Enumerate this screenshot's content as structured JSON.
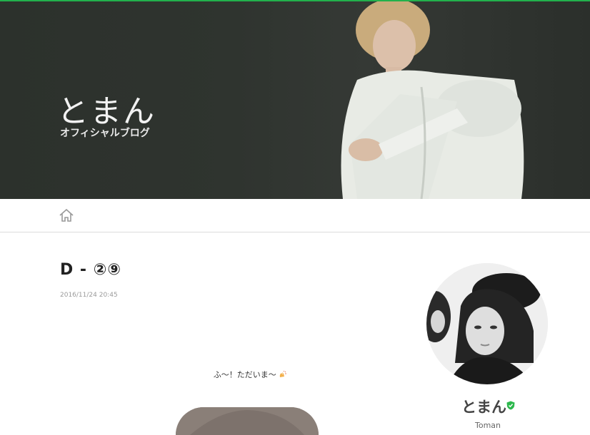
{
  "header": {
    "blog_title": "とまん",
    "blog_subtitle": "オフィシャルブログ"
  },
  "nav": {
    "home_icon": "home-icon"
  },
  "entry": {
    "title": "D - ②⑨",
    "date": "2016/11/24 20:45",
    "body_text": "ふ〜！ただいま〜",
    "body_emoji": "clap-icon"
  },
  "profile": {
    "name": "とまん",
    "name_en": "Toman",
    "verified_icon": "verified-badge-icon"
  },
  "colors": {
    "accent": "#22b14c",
    "header_bg": "#2f342f",
    "verified": "#2db84d"
  }
}
